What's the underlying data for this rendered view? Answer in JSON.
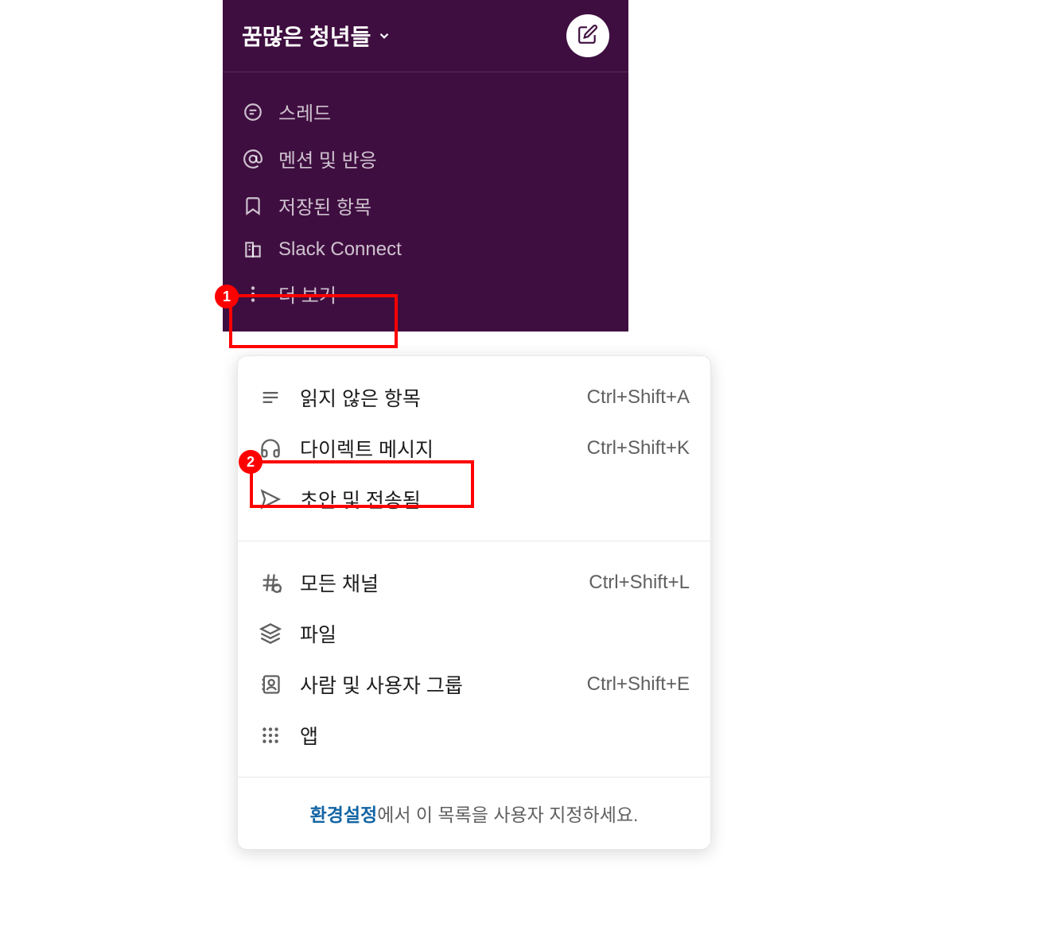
{
  "header": {
    "workspace_name": "꿈많은 청년들"
  },
  "nav": {
    "items": [
      {
        "label": "스레드"
      },
      {
        "label": "멘션 및 반응"
      },
      {
        "label": "저장된 항목"
      },
      {
        "label": "Slack Connect"
      },
      {
        "label": "더 보기"
      }
    ]
  },
  "popup": {
    "section1": [
      {
        "label": "읽지 않은 항목",
        "shortcut": "Ctrl+Shift+A"
      },
      {
        "label": "다이렉트 메시지",
        "shortcut": "Ctrl+Shift+K"
      },
      {
        "label": "초안 및 전송됨",
        "shortcut": ""
      }
    ],
    "section2": [
      {
        "label": "모든 채널",
        "shortcut": "Ctrl+Shift+L"
      },
      {
        "label": "파일",
        "shortcut": ""
      },
      {
        "label": "사람 및 사용자 그룹",
        "shortcut": "Ctrl+Shift+E"
      },
      {
        "label": "앱",
        "shortcut": ""
      }
    ],
    "footer_link": "환경설정",
    "footer_text": "에서 이 목록을 사용자 지정하세요."
  },
  "annotations": {
    "badge1": "1",
    "badge2": "2"
  }
}
